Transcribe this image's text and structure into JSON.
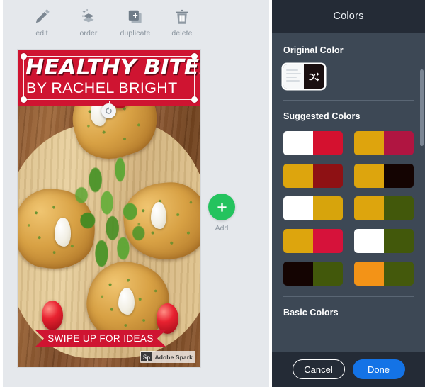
{
  "toolbar": {
    "items": [
      {
        "label": "edit",
        "icon": "pencil-icon"
      },
      {
        "label": "order",
        "icon": "layers-order-icon"
      },
      {
        "label": "duplicate",
        "icon": "duplicate-icon"
      },
      {
        "label": "delete",
        "icon": "trash-icon"
      }
    ]
  },
  "canvas": {
    "card": {
      "banner_color": "#cf1431",
      "title": "HEALTHY BITES",
      "subtitle": "BY RACHEL BRIGHT",
      "swipe_banner": "SWIPE UP FOR IDEAS",
      "watermark": {
        "mark": "Sp",
        "text": "Adobe Spark"
      },
      "photo_description": "garlic bread slices with parsley and cherry tomatoes on a wooden board"
    },
    "selection": {
      "handles": 4,
      "rotate_icon": "rotate-icon"
    },
    "add_button": {
      "label": "Add",
      "icon": "plus-icon",
      "color": "#24c35e"
    }
  },
  "panel": {
    "title": "Colors",
    "original": {
      "section_label": "Original Color",
      "shuffle_icon": "shuffle-icon",
      "left_color": "#f7f8f9",
      "right_color": "#1a0f10"
    },
    "suggested": {
      "section_label": "Suggested Colors",
      "swatches": [
        {
          "left": "#ffffff",
          "right": "#d4112f"
        },
        {
          "left": "#dea40d",
          "right": "#b01541"
        },
        {
          "left": "#dda50d",
          "right": "#8e1114"
        },
        {
          "left": "#dda50d",
          "right": "#140402"
        },
        {
          "left": "#ffffff",
          "right": "#d7a40c"
        },
        {
          "left": "#dda50d",
          "right": "#42580b"
        },
        {
          "left": "#dda50d",
          "right": "#d6123a"
        },
        {
          "left": "#ffffff",
          "right": "#42580b"
        },
        {
          "left": "#140402",
          "right": "#42580b"
        },
        {
          "left": "#f39317",
          "right": "#44590c"
        }
      ]
    },
    "basic": {
      "section_label": "Basic Colors"
    },
    "footer": {
      "cancel_label": "Cancel",
      "done_label": "Done",
      "done_color": "#1473e6"
    }
  }
}
